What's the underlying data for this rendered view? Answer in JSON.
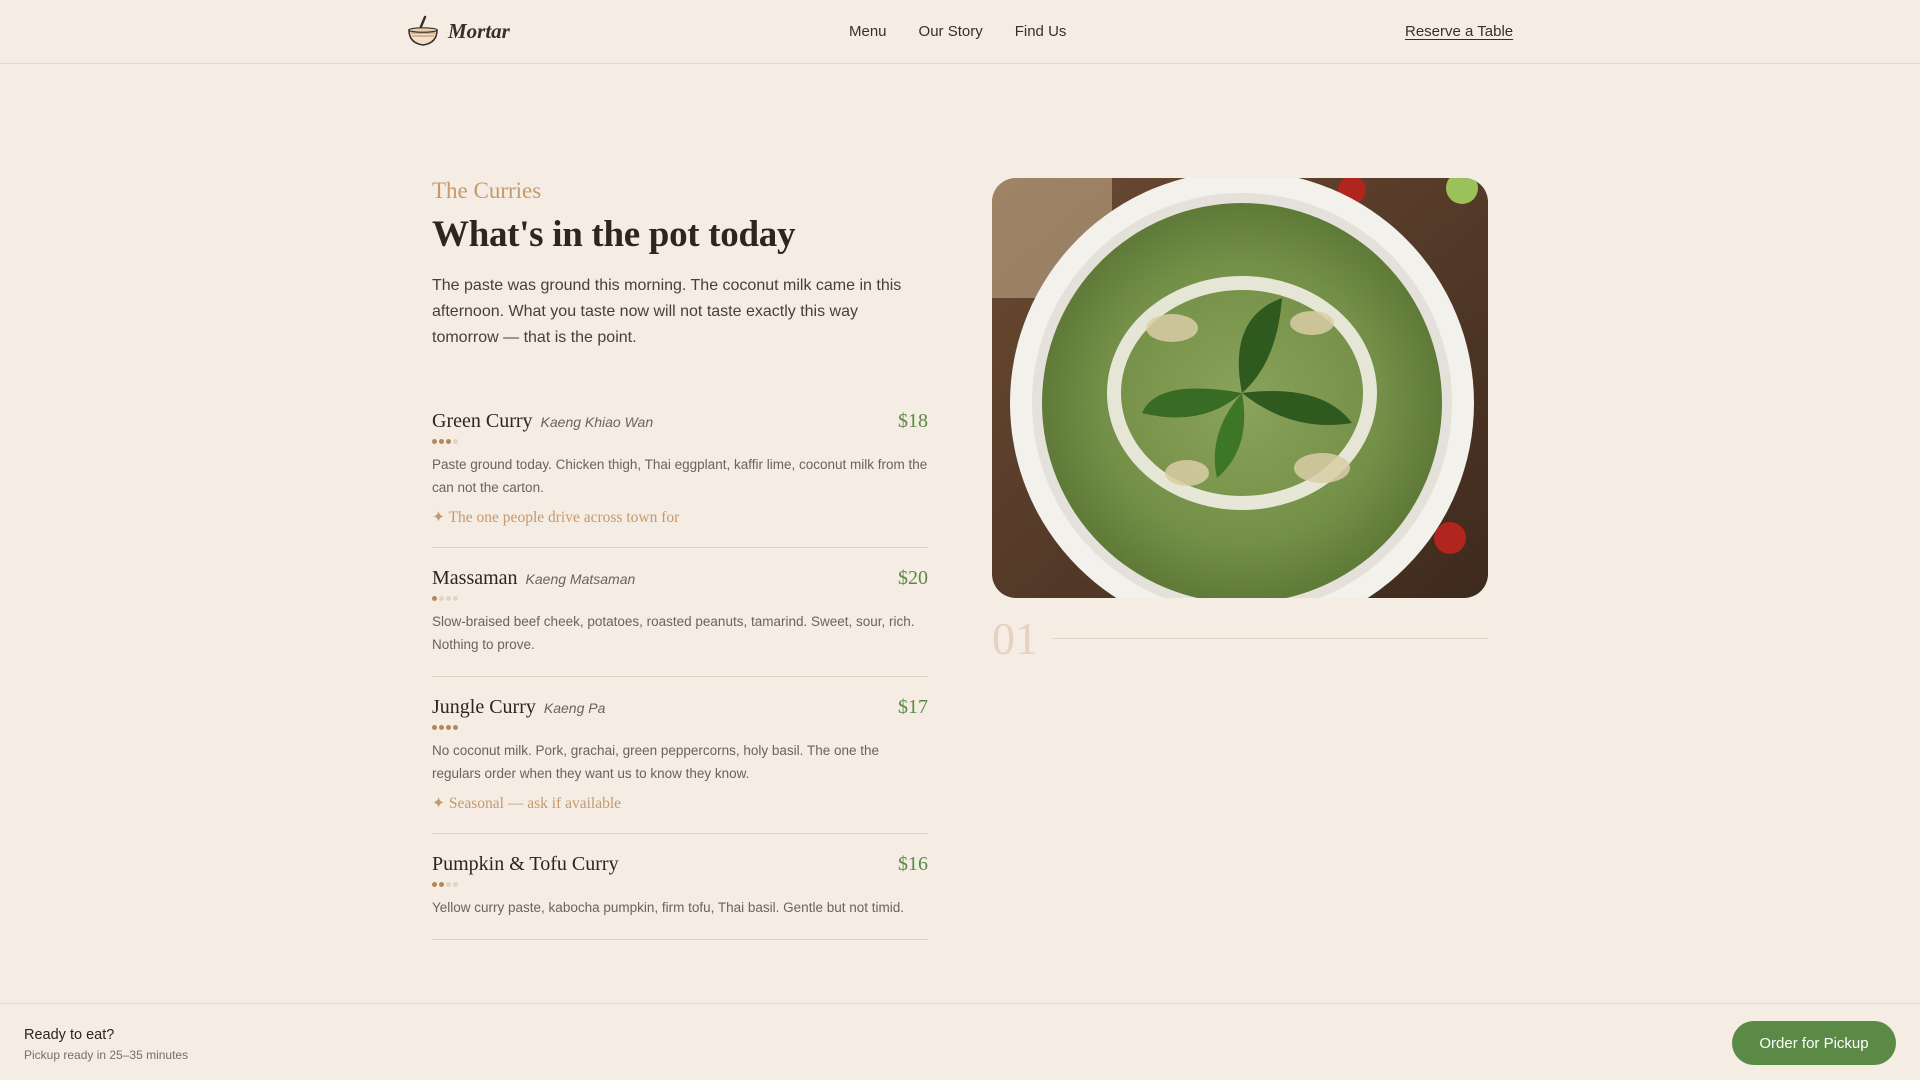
{
  "brand": {
    "name": "Mortar",
    "icon": "mortar-pestle-icon"
  },
  "nav": {
    "items": [
      "Menu",
      "Our Story",
      "Find Us"
    ],
    "reserve_label": "Reserve a Table"
  },
  "section": {
    "eyebrow": "The Curries",
    "headline": "What's in the pot today",
    "intro": "The paste was ground this morning. The coconut milk came in this afternoon. What you taste now will not taste exactly this way tomorrow — that is the point."
  },
  "menu": [
    {
      "name": "Green Curry",
      "thai": "Kaeng Khiao Wan",
      "price": "$18",
      "spice": 3,
      "spice_max": 4,
      "desc": "Paste ground today. Chicken thigh, Thai eggplant, kaffir lime, coconut milk from the can not the carton.",
      "note": "✦ The one people drive across town for"
    },
    {
      "name": "Massaman",
      "thai": "Kaeng Matsaman",
      "price": "$20",
      "spice": 1,
      "spice_max": 4,
      "desc": "Slow-braised beef cheek, potatoes, roasted peanuts, tamarind. Sweet, sour, rich. Nothing to prove.",
      "note": ""
    },
    {
      "name": "Jungle Curry",
      "thai": "Kaeng Pa",
      "price": "$17",
      "spice": 4,
      "spice_max": 4,
      "desc": "No coconut milk. Pork, grachai, green peppercorns, holy basil. The one the regulars order when they want us to know they know.",
      "note": "✦ Seasonal — ask if available"
    },
    {
      "name": "Pumpkin & Tofu Curry",
      "thai": "",
      "price": "$16",
      "spice": 2,
      "spice_max": 4,
      "desc": "Yellow curry paste, kabocha pumpkin, firm tofu, Thai basil. Gentle but not timid.",
      "note": ""
    }
  ],
  "feature": {
    "counter": "01",
    "image": "green-curry-bowl-photo"
  },
  "bottom": {
    "ready": "Ready to eat?",
    "pickup": "Pickup ready in 25–35 minutes",
    "order_label": "Order for Pickup"
  },
  "colors": {
    "background": "#f5ece3",
    "accent_green": "#5a8a45",
    "accent_tan": "#c49a6c"
  }
}
